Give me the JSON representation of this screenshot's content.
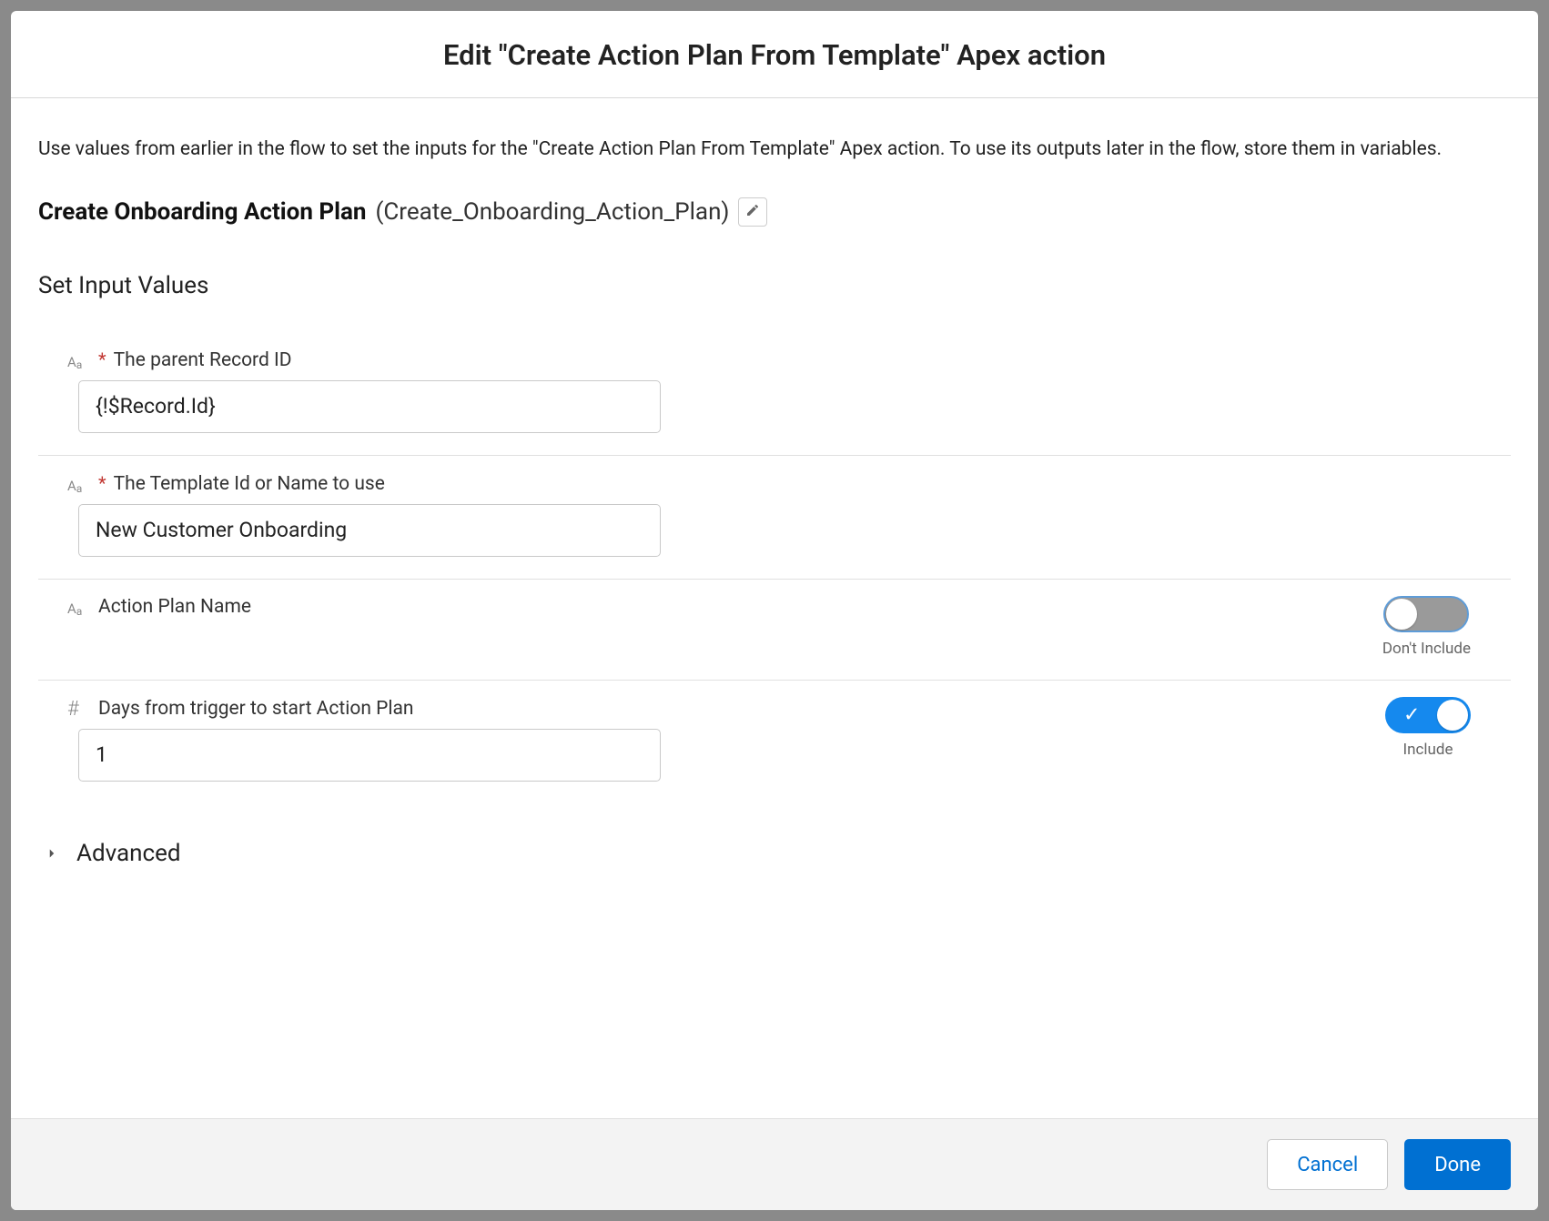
{
  "header": {
    "title": "Edit \"Create Action Plan From Template\" Apex action"
  },
  "body": {
    "description": "Use values from earlier in the flow to set the inputs for the \"Create Action Plan From Template\" Apex action. To use its outputs later in the flow, store them in variables.",
    "action_label": "Create Onboarding Action Plan",
    "action_api": "(Create_Onboarding_Action_Plan)",
    "section_heading": "Set Input Values",
    "fields": {
      "parent_record": {
        "label": "The parent Record ID",
        "value": "{!$Record.Id}"
      },
      "template": {
        "label": "The Template Id or Name to use",
        "value": "New Customer Onboarding"
      },
      "action_plan_name": {
        "label": "Action Plan Name",
        "toggle_label": "Don't Include"
      },
      "days_from_trigger": {
        "label": "Days from trigger to start Action Plan",
        "value": "1",
        "toggle_label": "Include"
      }
    },
    "advanced_label": "Advanced"
  },
  "footer": {
    "cancel": "Cancel",
    "done": "Done"
  }
}
